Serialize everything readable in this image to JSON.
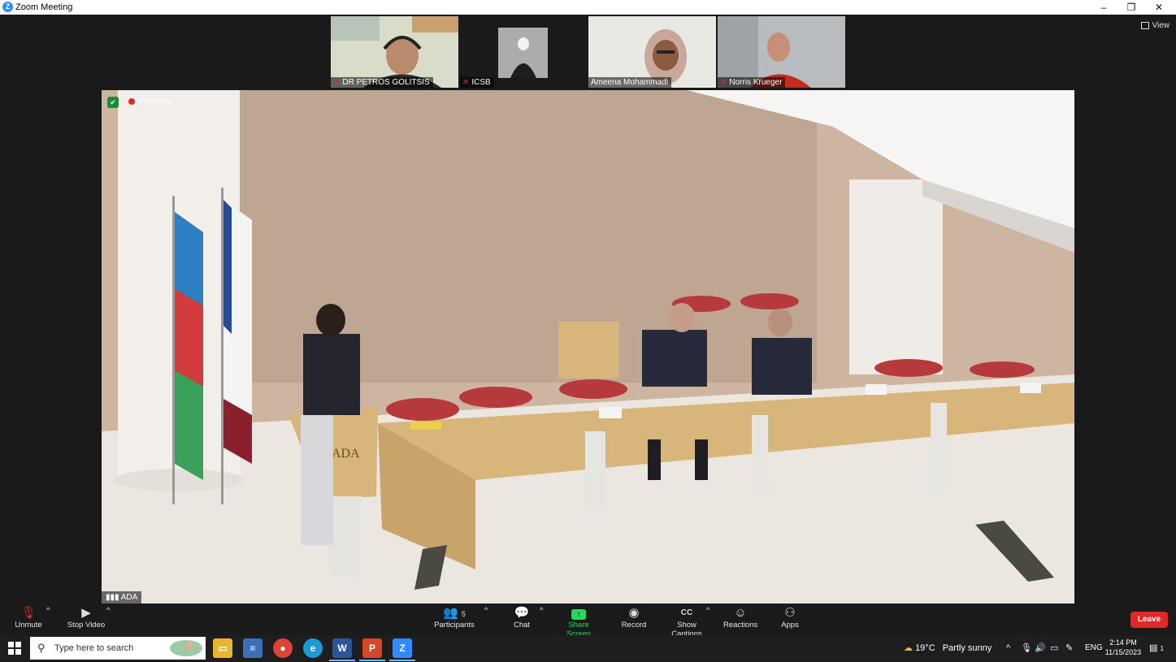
{
  "window": {
    "app_icon": "zoom-logo-icon",
    "title": "Zoom Meeting",
    "minimize": "–",
    "restore": "❐",
    "close": "✕"
  },
  "view_button": {
    "label": "View",
    "icon": "grid-view-icon"
  },
  "gallery": [
    {
      "name": "DR PETROS GOLITSIS",
      "muted": true
    },
    {
      "name": "ICSB",
      "muted": true
    },
    {
      "name": "Ameena Mohammadi",
      "muted": false
    },
    {
      "name": "Norris Krueger",
      "muted": true
    }
  ],
  "main_video": {
    "recording_label": "Recording",
    "feed_name": "ADA",
    "podium_text": "ADA"
  },
  "toolbar": {
    "unmute": "Unmute",
    "stop_video": "Stop Video",
    "participants": "Participants",
    "participants_count": "5",
    "chat": "Chat",
    "share_screen": "Share Screen",
    "record": "Record",
    "show_captions": "Show Captions",
    "reactions": "Reactions",
    "apps": "Apps",
    "leave": "Leave",
    "accent": "#23d959",
    "leave_color": "#e02828"
  },
  "taskbar": {
    "search_placeholder": "Type here to search",
    "apps": [
      "file-explorer-icon",
      "notepad-icon",
      "chrome-icon",
      "edge-icon",
      "word-icon",
      "powerpoint-icon",
      "zoom-icon"
    ],
    "weather_temp": "19°C",
    "weather_text": "Partly sunny",
    "lang": "ENG",
    "time": "2:14 PM",
    "date": "11/15/2023",
    "notification_count": "1"
  }
}
